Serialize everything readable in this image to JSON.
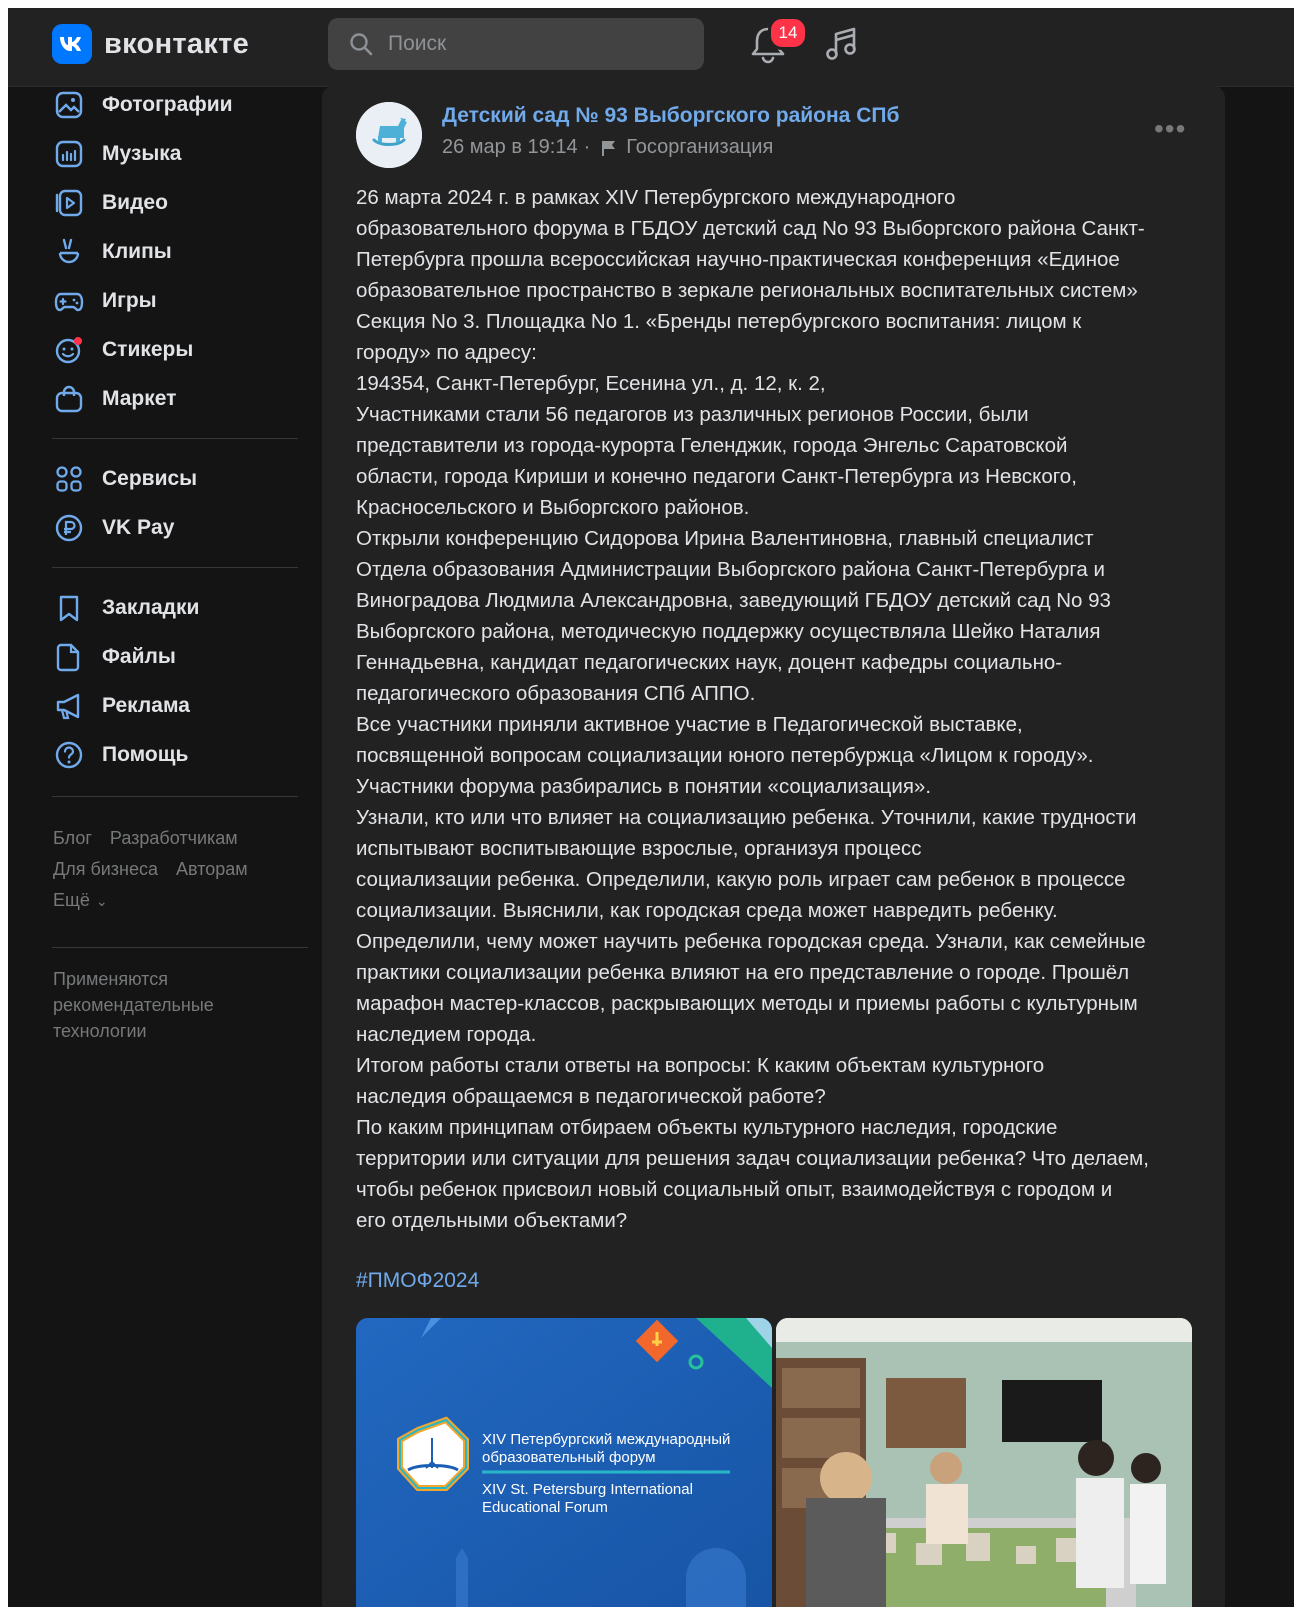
{
  "header": {
    "logo_short": "VK",
    "logo_text": "вконтакте",
    "search_placeholder": "Поиск",
    "notifications_count": "14"
  },
  "sidebar": {
    "items": [
      {
        "label": "Фотографии",
        "icon": "photos-icon"
      },
      {
        "label": "Музыка",
        "icon": "music-icon"
      },
      {
        "label": "Видео",
        "icon": "video-icon"
      },
      {
        "label": "Клипы",
        "icon": "clips-icon"
      },
      {
        "label": "Игры",
        "icon": "games-icon"
      },
      {
        "label": "Стикеры",
        "icon": "stickers-icon"
      },
      {
        "label": "Маркет",
        "icon": "market-icon"
      },
      {
        "label": "Сервисы",
        "icon": "services-icon"
      },
      {
        "label": "VK Pay",
        "icon": "vkpay-icon"
      },
      {
        "label": "Закладки",
        "icon": "bookmarks-icon"
      },
      {
        "label": "Файлы",
        "icon": "files-icon"
      },
      {
        "label": "Реклама",
        "icon": "ads-icon"
      },
      {
        "label": "Помощь",
        "icon": "help-icon"
      }
    ],
    "footer_links": [
      "Блог",
      "Разработчикам",
      "Для бизнеса",
      "Авторам",
      "Ещё"
    ],
    "recommendation_note": "Применяются рекомендательные технологии"
  },
  "post": {
    "author": "Детский сад № 93 Выборгского района СПб",
    "date": "26 мар в 19:14",
    "separator": "·",
    "org_type": "Госорганизация",
    "lines": [
      "26 марта 2024 г. в рамках XIV Петербургского международного",
      "образовательного форума в ГБДОУ детский сад No 93 Выборгского района Санкт-",
      "Петербурга прошла всероссийская научно-практическая конференция «Единое",
      "образовательное пространство в зеркале региональных воспитательных систем»",
      "Секция No 3. Площадка No 1. «Бренды петербургского воспитания: лицом к",
      "городу» по адресу:",
      "194354, Санкт-Петербург, Есенина ул., д. 12, к. 2,",
      "Участниками стали 56 педагогов из различных регионов России, были",
      "представители из города-курорта Геленджик, города Энгельс Саратовской",
      "области, города Кириши и конечно педагоги Санкт-Петербурга из Невского,",
      "Красносельского и Выборгского районов.",
      "Открыли конференцию Сидорова Ирина Валентиновна, главный специалист",
      "Отдела образования Администрации Выборгского района Санкт-Петербурга и",
      "Виноградова Людмила Александровна, заведующий ГБДОУ детский сад No 93",
      "Выборгского района, методическую поддержку осуществляла Шейко Наталия",
      "Геннадьевна, кандидат педагогических наук, доцент кафедры социально-",
      "педагогического образования СПб АППО.",
      "Все участники приняли активное участие в Педагогической выставке,",
      "посвященной вопросам социализации юного петербуржца «Лицом к городу».",
      "Участники форума разбирались в понятии «социализация».",
      "Узнали, кто или что влияет на социализацию ребенка. Уточнили, какие трудности",
      "испытывают воспитывающие взрослые, организуя процесс",
      "социализации ребенка. Определили, какую роль играет сам ребенок в процессе",
      "социализации. Выяснили, как городская среда может навредить ребенку.",
      "Определили, чему может научить ребенка городская среда. Узнали, как семейные",
      "практики социализации ребенка влияют на его представление о городе. Прошёл",
      "марафон мастер-классов, раскрывающих методы и приемы работы с культурным",
      "наследием города.",
      "Итогом работы стали ответы на вопросы: К каким объектам культурного",
      "наследия обращаемся в педагогической работе?",
      "По каким принципам отбираем объекты культурного наследия, городские",
      "территории или ситуации для решения задач социализации ребенка? Что делаем,",
      "чтобы ребенок присвоил новый социальный опыт, взаимодействуя с городом и",
      "его отдельными объектами?"
    ],
    "hashtag": "#ПМОФ2024",
    "photo1": {
      "line1": "XIV Петербургский международный",
      "line2": "образовательный форум",
      "line3": "XIV St. Petersburg International",
      "line4": "Educational Forum"
    }
  },
  "colors": {
    "background": "#141414",
    "panel": "#222222",
    "accent": "#71aaeb",
    "brand": "#0077ff",
    "badge": "#ff3347",
    "text": "#e1e3e6",
    "muted": "#939699"
  }
}
